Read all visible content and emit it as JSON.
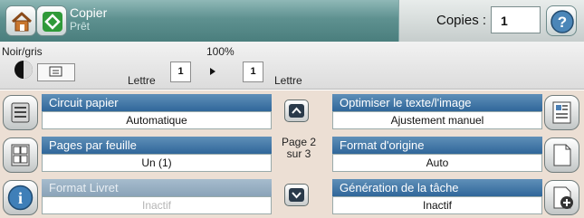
{
  "header": {
    "title": "Copier",
    "subtitle": "Prêt",
    "copies_label": "Copies :",
    "copies_value": "1"
  },
  "settings": {
    "color_mode": "Noir/gris",
    "zoom": "100%",
    "source_paper": "Lettre",
    "source_count": "1",
    "dest_count": "1",
    "dest_paper": "Lettre"
  },
  "options": [
    {
      "label": "Circuit papier",
      "value": "Automatique",
      "disabled": false
    },
    {
      "label": "Pages par feuille",
      "value": "Un (1)",
      "disabled": false
    },
    {
      "label": "Format Livret",
      "value": "Inactif",
      "disabled": true
    },
    {
      "label": "Optimiser le texte/l'image",
      "value": "Ajustement manuel",
      "disabled": false
    },
    {
      "label": "Format d'origine",
      "value": "Auto",
      "disabled": false
    },
    {
      "label": "Génération de la tâche",
      "value": "Inactif",
      "disabled": false
    }
  ],
  "pager": {
    "line1": "Page 2",
    "line2": "sur 3"
  },
  "colors": {
    "header_teal": "#5e9190",
    "option_blue": "#30679a",
    "grid_bg": "#ecdfd4"
  }
}
